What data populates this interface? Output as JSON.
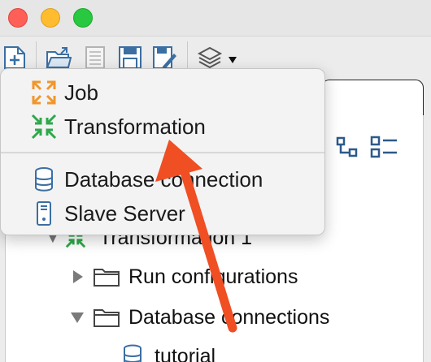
{
  "menu": {
    "items": [
      {
        "label": "Job",
        "icon": "job-icon"
      },
      {
        "label": "Transformation",
        "icon": "transformation-icon"
      },
      {
        "label": "Database connection",
        "icon": "database-icon"
      },
      {
        "label": "Slave Server",
        "icon": "server-icon"
      }
    ]
  },
  "tree": {
    "items": [
      {
        "label": "Transformation 1",
        "icon": "transformation-icon",
        "expanded": true
      },
      {
        "label": "Run configurations",
        "icon": "folder-icon",
        "expanded": false
      },
      {
        "label": "Database connections",
        "icon": "folder-icon",
        "expanded": true
      },
      {
        "label": "tutorial",
        "icon": "database-icon"
      }
    ]
  },
  "colors": {
    "annotation_arrow": "#f04e23",
    "job_orange": "#f0962c",
    "transformation_green": "#2ea84a"
  }
}
